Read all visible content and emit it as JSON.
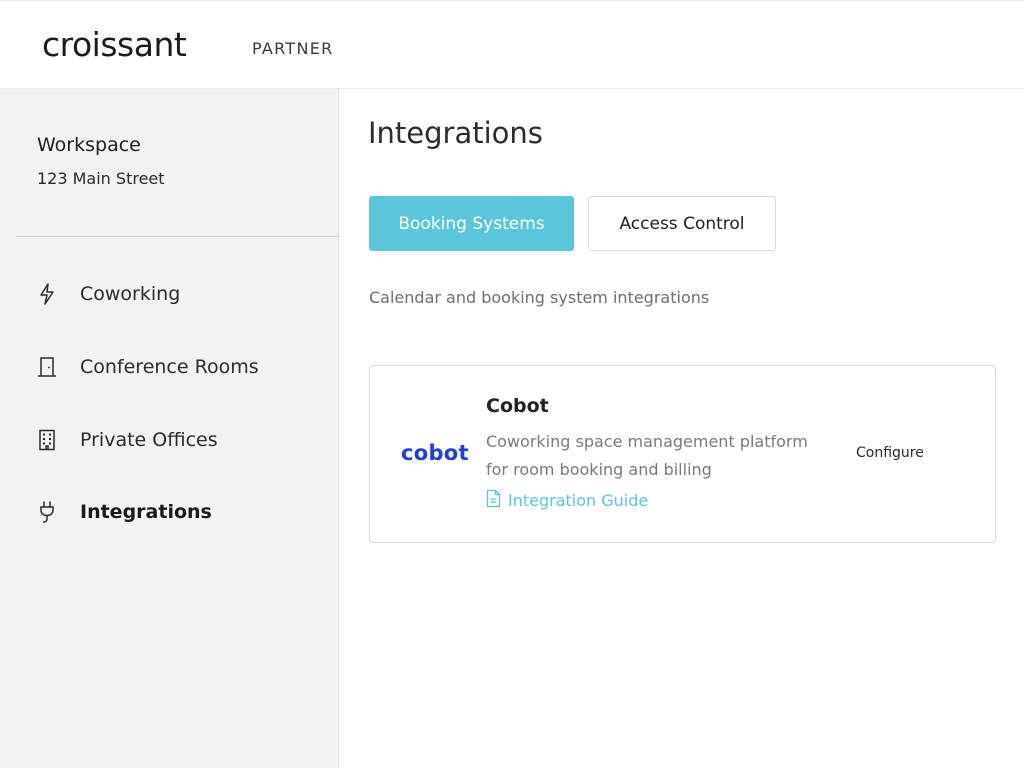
{
  "header": {
    "logo_text": "croissant",
    "section_label": "PARTNER"
  },
  "sidebar": {
    "workspace_name": "Workspace",
    "workspace_address": "123 Main Street",
    "items": [
      {
        "label": "Coworking",
        "icon": "lightning-icon",
        "active": false
      },
      {
        "label": "Conference Rooms",
        "icon": "door-icon",
        "active": false
      },
      {
        "label": "Private Offices",
        "icon": "building-icon",
        "active": false
      },
      {
        "label": "Integrations",
        "icon": "plug-icon",
        "active": true
      }
    ]
  },
  "main": {
    "title": "Integrations",
    "tabs": [
      {
        "label": "Booking Systems",
        "selected": true
      },
      {
        "label": "Access Control",
        "selected": false
      }
    ],
    "tab_description": "Calendar and booking system integrations",
    "integrations": [
      {
        "logo_text": "cobot",
        "name": "Cobot",
        "description": "Coworking space management platform for room booking and billing",
        "guide_label": "Integration Guide",
        "action_label": "Configure"
      }
    ]
  },
  "colors": {
    "accent": "#5bc5db",
    "sidebar_bg": "#f2f2f2",
    "cobot_brand": "#1b3fe0"
  }
}
